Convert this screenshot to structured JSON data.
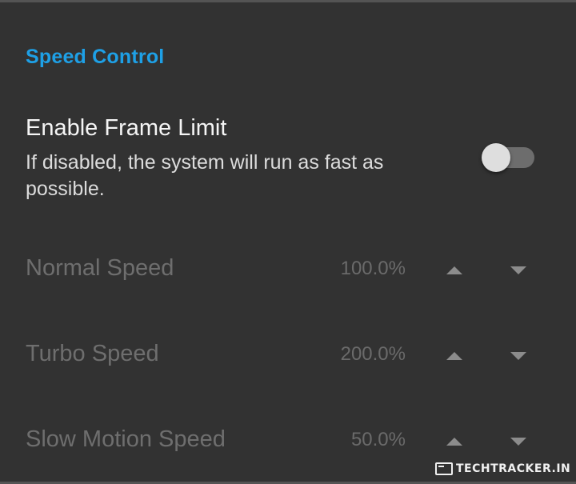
{
  "section": {
    "title": "Speed Control"
  },
  "frame_limit": {
    "title": "Enable Frame Limit",
    "description": "If disabled, the system will run as fast as possible.",
    "enabled": false
  },
  "speed_rows": [
    {
      "label": "Normal Speed",
      "value": "100.0%"
    },
    {
      "label": "Turbo Speed",
      "value": "200.0%"
    },
    {
      "label": "Slow Motion Speed",
      "value": "50.0%"
    }
  ],
  "icons": {
    "increase": "triangle-up-icon",
    "decrease": "triangle-down-icon"
  },
  "colors": {
    "background": "#323232",
    "accent": "#1ea0e6",
    "disabled_text": "#6e6e6e"
  },
  "watermark": {
    "text": "TECHTRACKER.IN"
  }
}
